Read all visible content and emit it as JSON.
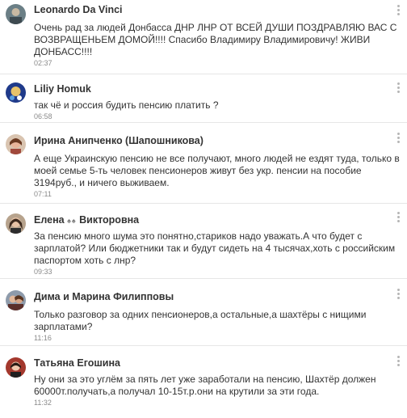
{
  "comments": [
    {
      "author": "Leonardo Da Vinci",
      "text": "Очень рад за людей Донбасса ДНР ЛНР  ОТ ВСЕЙ ДУШИ ПОЗДРАВЛЯЮ ВАС С ВОЗВРАЩЕНЬЕМ ДОМОЙ!!!! Спасибо Владимиру Владимировичу! ЖИВИ ДОНБАСС!!!!",
      "time": "02:37"
    },
    {
      "author": "Liliy Homuk",
      "text": "так чё  и россия   будить  пенсию платить ?",
      "time": "06:58"
    },
    {
      "author": "Ирина Анипченко (Шапошникова)",
      "text": "А еще Украинскую пенсию не все получают, много людей не ездят туда, только в моей семье 5-ть человек пенсионеров живут без укр. пенсии на пособие 3194руб., и ничего выживаем.",
      "time": "07:11"
    },
    {
      "author_first": "Елена",
      "author_emoji": "♠♠",
      "author_last": "Викторовна",
      "text": "За пенсию много шума это понятно,стариков надо уважать.А что будет с зарплатой? Или бюджетники так и будут сидеть на 4 тысячах,хоть с российским паспортом хоть с лнр?",
      "time": "09:33"
    },
    {
      "author": "Дима и Марина Филипповы",
      "text": "Только разговор за одних пенсионеров,а остальные,а шахтёры с нищими зарплатами?",
      "time": "11:16"
    },
    {
      "author": "Татьяна Егошина",
      "text": "Ну они за это углём за пять лет уже заработали на пенсию, Шахтёр должен 60000т.получать,а получал 10-15т.р.они на крутили за эти года.",
      "time": "11:32"
    }
  ]
}
